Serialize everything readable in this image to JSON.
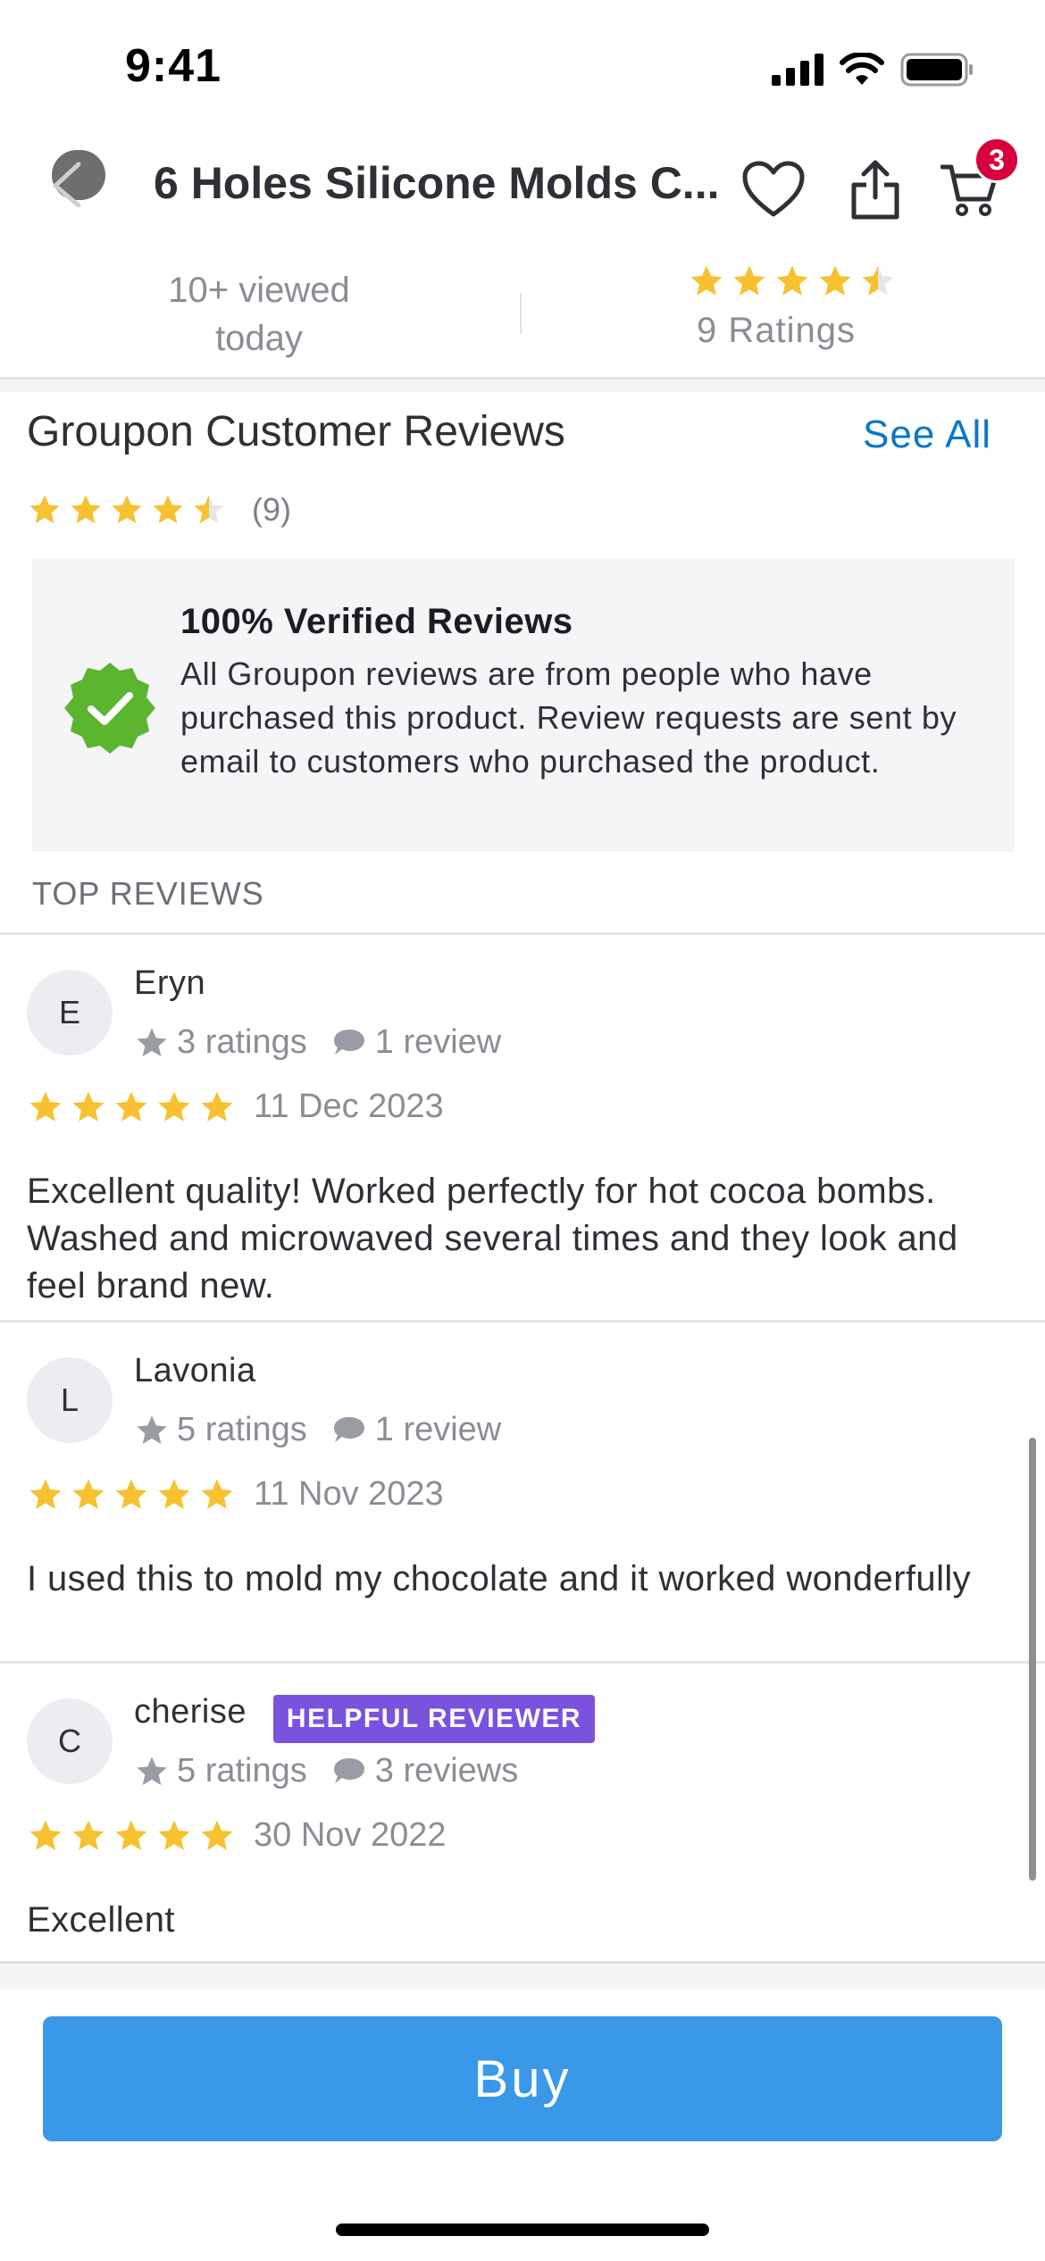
{
  "status_bar": {
    "time": "9:41"
  },
  "nav": {
    "title": "6 Holes Silicone Molds C...",
    "cart_count": "3"
  },
  "summary": {
    "viewed_line1": "10+ viewed",
    "viewed_line2": "today",
    "rating": 4.5,
    "ratings_label": "9  Ratings"
  },
  "reviews_section": {
    "title": "Groupon Customer Reviews",
    "see_all": "See All",
    "rating": 4.5,
    "count": "(9)",
    "verified": {
      "title": "100% Verified Reviews",
      "text": "All Groupon reviews are from people who have purchased this product. Review requests are sent by email to customers who purchased the product."
    },
    "top_reviews_label": "TOP REVIEWS",
    "reviews": [
      {
        "initial": "E",
        "name": "Eryn",
        "ratings": "3 ratings",
        "review_count": "1 review",
        "stars": 5,
        "date": "11 Dec 2023",
        "body": "Excellent quality! Worked perfectly for hot cocoa bombs. Washed and microwaved several times and they look and feel brand new.",
        "badge": ""
      },
      {
        "initial": "L",
        "name": "Lavonia",
        "ratings": "5 ratings",
        "review_count": "1 review",
        "stars": 5,
        "date": "11 Nov 2023",
        "body": "I used this to mold my chocolate and it worked wonderfully",
        "badge": ""
      },
      {
        "initial": "C",
        "name": "cherise",
        "ratings": "5 ratings",
        "review_count": "3 reviews",
        "stars": 5,
        "date": "30 Nov 2022",
        "body": "Excellent",
        "badge": "HELPFUL REVIEWER"
      }
    ]
  },
  "buy_button": "Buy",
  "colors": {
    "star": "#f7c12f",
    "star_empty": "#e6e6e6",
    "link": "#0b77c9",
    "buy": "#3a98e8",
    "badge_helpful": "#7b52de",
    "verified_green": "#5bb52f",
    "cart_badge": "#d6003a"
  },
  "icons": [
    "back-arrow-icon",
    "heart-icon",
    "share-icon",
    "cart-icon",
    "star-icon",
    "comment-icon",
    "verified-check-icon"
  ]
}
